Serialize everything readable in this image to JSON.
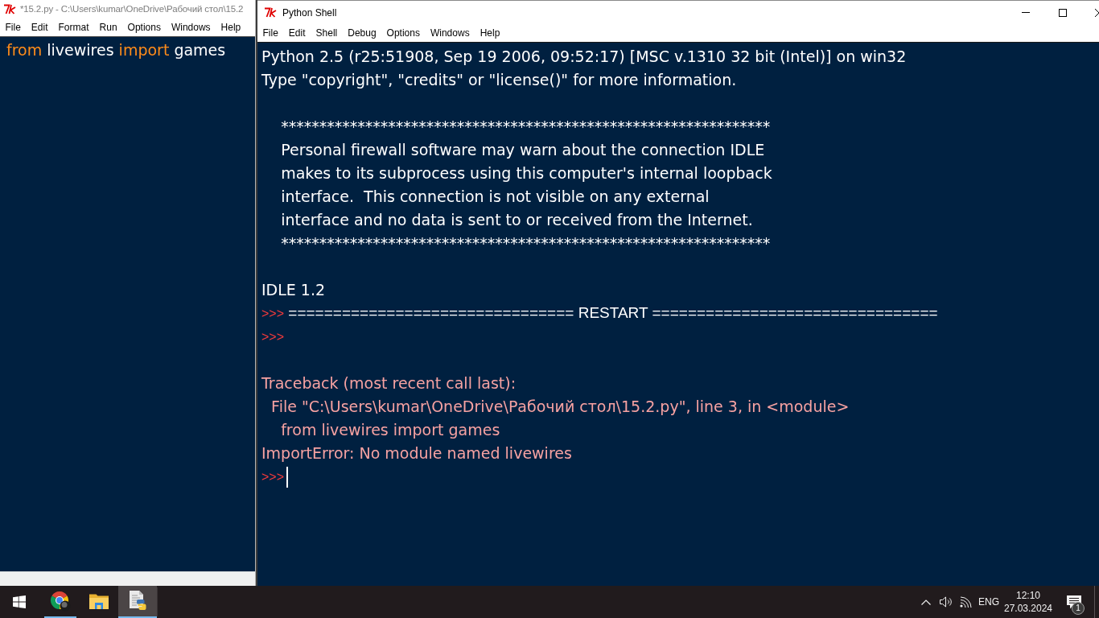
{
  "editor_window": {
    "title": "*15.2.py - C:\\Users\\kumar\\OneDrive\\Рабочий стол\\15.2",
    "active": false,
    "menu": [
      "File",
      "Edit",
      "Format",
      "Run",
      "Options",
      "Windows",
      "Help"
    ],
    "code": [
      {
        "tokens": [
          {
            "kind": "keyword",
            "text": "from"
          },
          {
            "kind": "name",
            "text": "livewires"
          },
          {
            "kind": "keyword",
            "text": "import"
          },
          {
            "kind": "name",
            "text": "games"
          }
        ]
      }
    ]
  },
  "shell_window": {
    "title": "Python Shell",
    "active": true,
    "menu": [
      "File",
      "Edit",
      "Shell",
      "Debug",
      "Options",
      "Windows",
      "Help"
    ],
    "lines": [
      {
        "kind": "output",
        "text": "Python 2.5 (r25:51908, Sep 19 2006, 09:52:17) [MSC v.1310 32 bit (Intel)] on win32"
      },
      {
        "kind": "output",
        "text": "Type \"copyright\", \"credits\" or \"license()\" for more information."
      },
      {
        "kind": "blank"
      },
      {
        "kind": "output",
        "text": "    ****************************************************************"
      },
      {
        "kind": "output",
        "text": "    Personal firewall software may warn about the connection IDLE"
      },
      {
        "kind": "output",
        "text": "    makes to its subprocess using this computer's internal loopback"
      },
      {
        "kind": "output",
        "text": "    interface.  This connection is not visible on any external"
      },
      {
        "kind": "output",
        "text": "    interface and no data is sent to or received from the Internet."
      },
      {
        "kind": "output",
        "text": "    ****************************************************************"
      },
      {
        "kind": "blank"
      },
      {
        "kind": "output",
        "text": "IDLE 1.2"
      },
      {
        "kind": "prompt",
        "prompt": ">>>",
        "text": "================================ RESTART ================================"
      },
      {
        "kind": "prompt",
        "prompt": ">>>"
      },
      {
        "kind": "blank"
      },
      {
        "kind": "error",
        "text": "Traceback (most recent call last):"
      },
      {
        "kind": "error",
        "text": "  File \"C:\\Users\\kumar\\OneDrive\\Рабочий стол\\15.2.py\", line 3, in <module>"
      },
      {
        "kind": "error",
        "text": "    from livewires import games"
      },
      {
        "kind": "error",
        "text": "ImportError: No module named livewires"
      },
      {
        "kind": "prompt",
        "prompt": ">>>",
        "cursor": true
      }
    ]
  },
  "taskbar": {
    "apps": [
      {
        "kind": "browser",
        "running": true,
        "selected": false
      },
      {
        "kind": "folder",
        "running": false,
        "selected": false
      },
      {
        "kind": "python",
        "running": true,
        "selected": true
      }
    ],
    "language": "ENG",
    "time": "12:10",
    "date": "27.03.2024",
    "notification_count": "1"
  }
}
